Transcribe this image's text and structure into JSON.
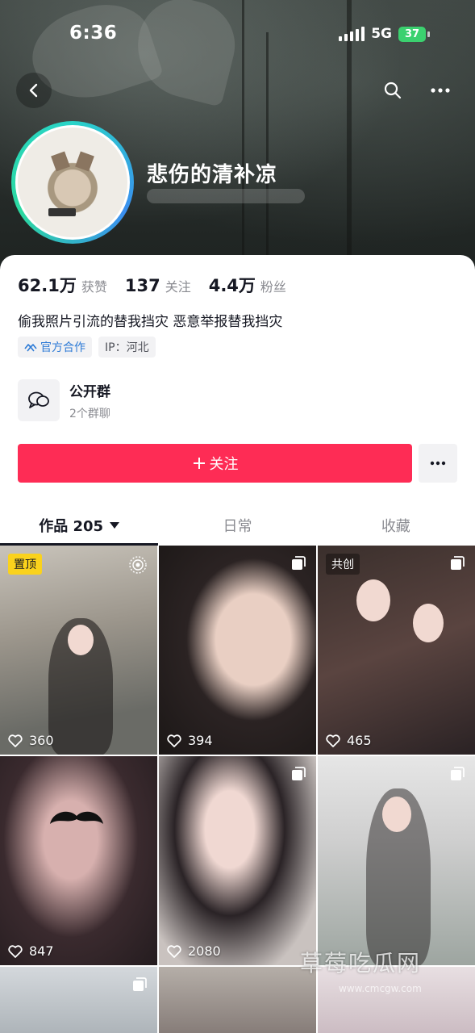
{
  "status_bar": {
    "time": "6:36",
    "network": "5G",
    "battery": "37"
  },
  "profile": {
    "name": "悲伤的清补凉",
    "stats": [
      {
        "value": "62.1万",
        "label": "获赞"
      },
      {
        "value": "137",
        "label": "关注"
      },
      {
        "value": "4.4万",
        "label": "粉丝"
      }
    ],
    "bio": "偷我照片引流的替我挡灾 恶意举报替我挡灾",
    "tags": {
      "official": "官方合作",
      "ip": "IP：河北"
    },
    "group": {
      "title": "公开群",
      "subtitle": "2个群聊"
    },
    "follow_label": "关注"
  },
  "tabs": [
    {
      "label": "作品 205"
    },
    {
      "label": "日常"
    },
    {
      "label": "收藏"
    }
  ],
  "grid": {
    "items": [
      {
        "likes": "360",
        "badge": "置顶"
      },
      {
        "likes": "394"
      },
      {
        "likes": "465",
        "badge": "共创"
      },
      {
        "likes": "847"
      },
      {
        "likes": "2080"
      },
      {
        "likes": ""
      }
    ]
  },
  "watermark": {
    "text": "草莓吃瓜网",
    "url": "www.cmcgw.com"
  },
  "colors": {
    "accent": "#fe2c55",
    "pin_badge": "#fad21c",
    "official": "#2e7bd6"
  }
}
